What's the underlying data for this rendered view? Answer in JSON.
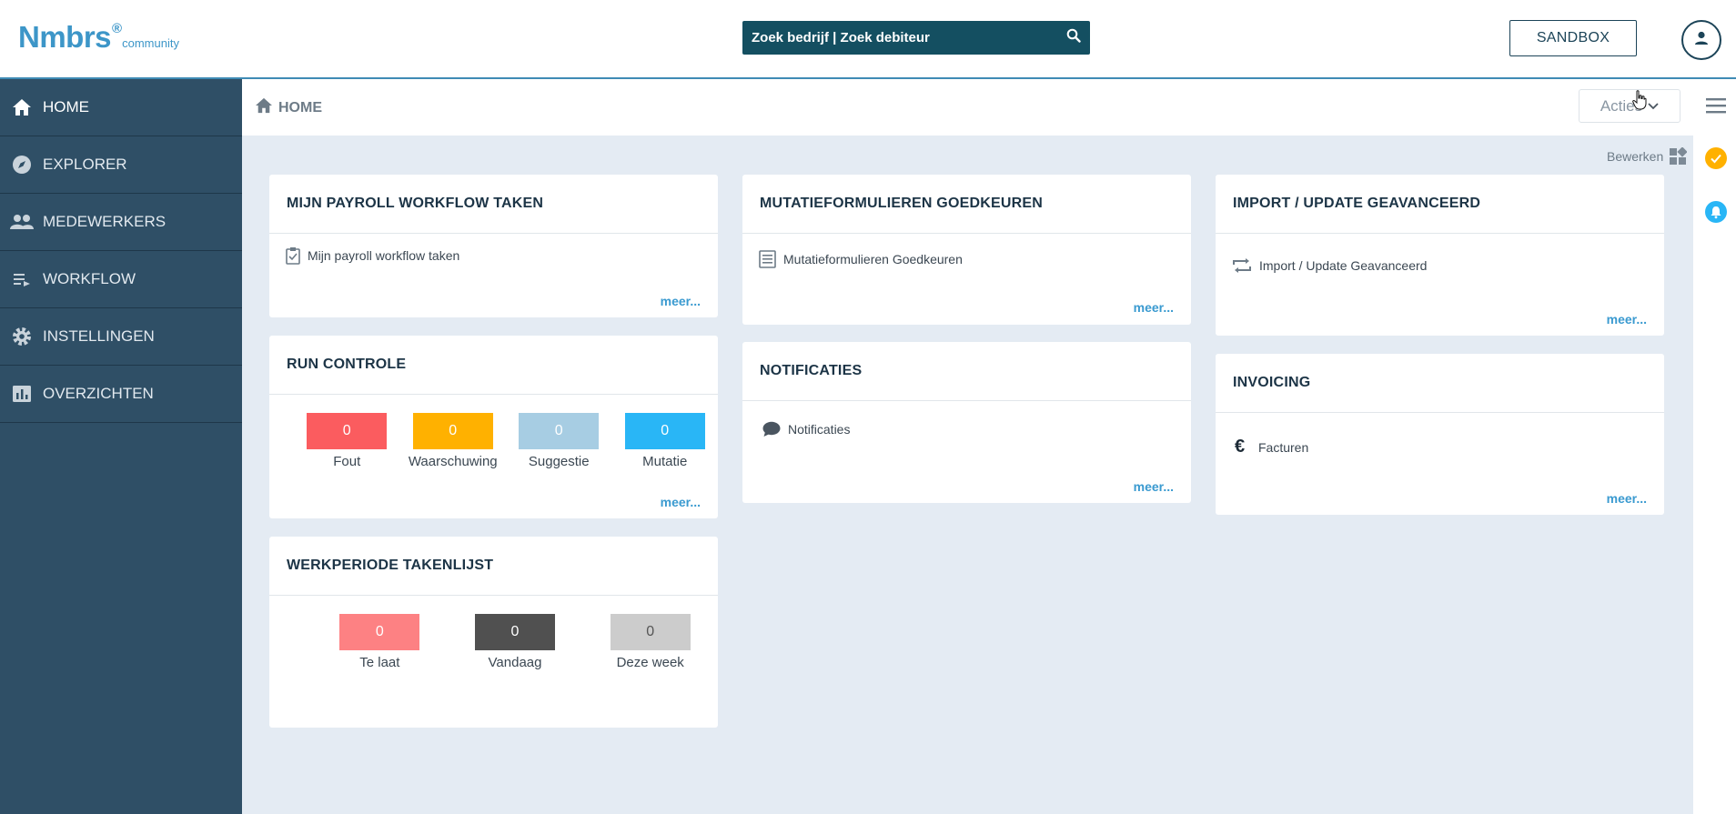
{
  "header": {
    "logo_main": "Nmbrs",
    "logo_reg": "®",
    "logo_sub": "community",
    "search_placeholder": "Zoek bedrijf | Zoek debiteur",
    "sandbox_label": "SANDBOX"
  },
  "sidebar": {
    "items": [
      {
        "label": "HOME",
        "icon": "home-icon"
      },
      {
        "label": "EXPLORER",
        "icon": "compass-icon"
      },
      {
        "label": "MEDEWERKERS",
        "icon": "people-icon"
      },
      {
        "label": "WORKFLOW",
        "icon": "playlist-icon"
      },
      {
        "label": "INSTELLINGEN",
        "icon": "gear-icon"
      },
      {
        "label": "OVERZICHTEN",
        "icon": "bar-chart-icon"
      }
    ]
  },
  "breadcrumb": {
    "label": "HOME"
  },
  "acties": {
    "label": "Acties"
  },
  "bewerken": {
    "label": "Bewerken"
  },
  "cards": {
    "payroll": {
      "title": "MIJN PAYROLL WORKFLOW TAKEN",
      "row": "Mijn payroll workflow taken",
      "meer": "meer..."
    },
    "mutatie": {
      "title": "MUTATIEFORMULIEREN GOEDKEUREN",
      "row": "Mutatieformulieren Goedkeuren",
      "meer": "meer..."
    },
    "import": {
      "title": "IMPORT / UPDATE GEAVANCEERD",
      "row": "Import / Update Geavanceerd",
      "meer": "meer..."
    },
    "run": {
      "title": "RUN CONTROLE",
      "meer": "meer...",
      "tiles": [
        {
          "value": "0",
          "label": "Fout",
          "color": "#fb5c5f"
        },
        {
          "value": "0",
          "label": "Waarschuwing",
          "color": "#ffb100"
        },
        {
          "value": "0",
          "label": "Suggestie",
          "color": "#a7cde3"
        },
        {
          "value": "0",
          "label": "Mutatie",
          "color": "#29b6f6"
        }
      ]
    },
    "notificaties": {
      "title": "NOTIFICATIES",
      "row": "Notificaties",
      "meer": "meer..."
    },
    "invoicing": {
      "title": "INVOICING",
      "row": "Facturen",
      "meer": "meer..."
    },
    "werkperiode": {
      "title": "WERKPERIODE TAKENLIJST",
      "tiles": [
        {
          "value": "0",
          "label": "Te laat",
          "color": "#fd8183"
        },
        {
          "value": "0",
          "label": "Vandaag",
          "color": "#505050"
        },
        {
          "value": "0",
          "label": "Deze week",
          "color": "#cccccc"
        }
      ]
    }
  }
}
